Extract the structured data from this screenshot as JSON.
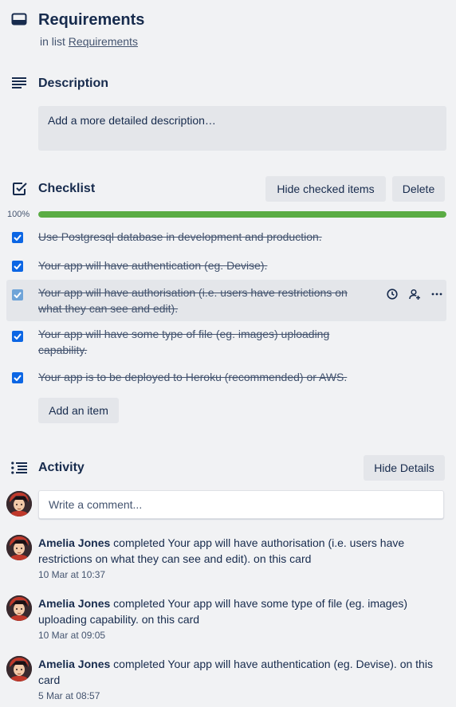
{
  "card": {
    "title": "Requirements",
    "in_list_prefix": "in list",
    "list_name": "Requirements"
  },
  "description": {
    "heading": "Description",
    "placeholder": "Add a more detailed description…"
  },
  "checklist": {
    "heading": "Checklist",
    "hide_checked_label": "Hide checked items",
    "delete_label": "Delete",
    "progress_text": "100%",
    "progress_value": 1.0,
    "items": [
      {
        "text": "Use Postgresql database in development and production.",
        "checked": true
      },
      {
        "text": "Your app will have authentication (eg. Devise).",
        "checked": true
      },
      {
        "text": "Your app will have authorisation (i.e. users have restrictions on what they can see and edit).",
        "checked": true
      },
      {
        "text": "Your app will have some type of file (eg. images) uploading capability.",
        "checked": true
      },
      {
        "text": "Your app is to be deployed to Heroku (recommended) or AWS.",
        "checked": true
      }
    ],
    "add_item_label": "Add an item"
  },
  "activity": {
    "heading": "Activity",
    "hide_details_label": "Hide Details",
    "comment_placeholder": "Write a comment...",
    "entries": [
      {
        "user": "Amelia Jones",
        "action": "completed Your app will have authorisation (i.e. users have restrictions on what they can see and edit). on this card",
        "time": "10 Mar at 10:37"
      },
      {
        "user": "Amelia Jones",
        "action": "completed Your app will have some type of file (eg. images) uploading capability. on this card",
        "time": "10 Mar at 09:05"
      },
      {
        "user": "Amelia Jones",
        "action": "completed Your app will have authentication (eg. Devise). on this card",
        "time": "5 Mar at 08:57"
      }
    ]
  },
  "colors": {
    "background": "#f1f2f4",
    "checkbox": "#0c66e4",
    "progress": "#5aac44",
    "text": "#172b4d"
  },
  "icons": {
    "card": "card-icon",
    "description": "description-lines-icon",
    "checklist": "checklist-icon",
    "activity": "activity-list-icon",
    "due_date": "clock-icon",
    "assign": "add-member-icon",
    "more": "more-dots-icon"
  }
}
